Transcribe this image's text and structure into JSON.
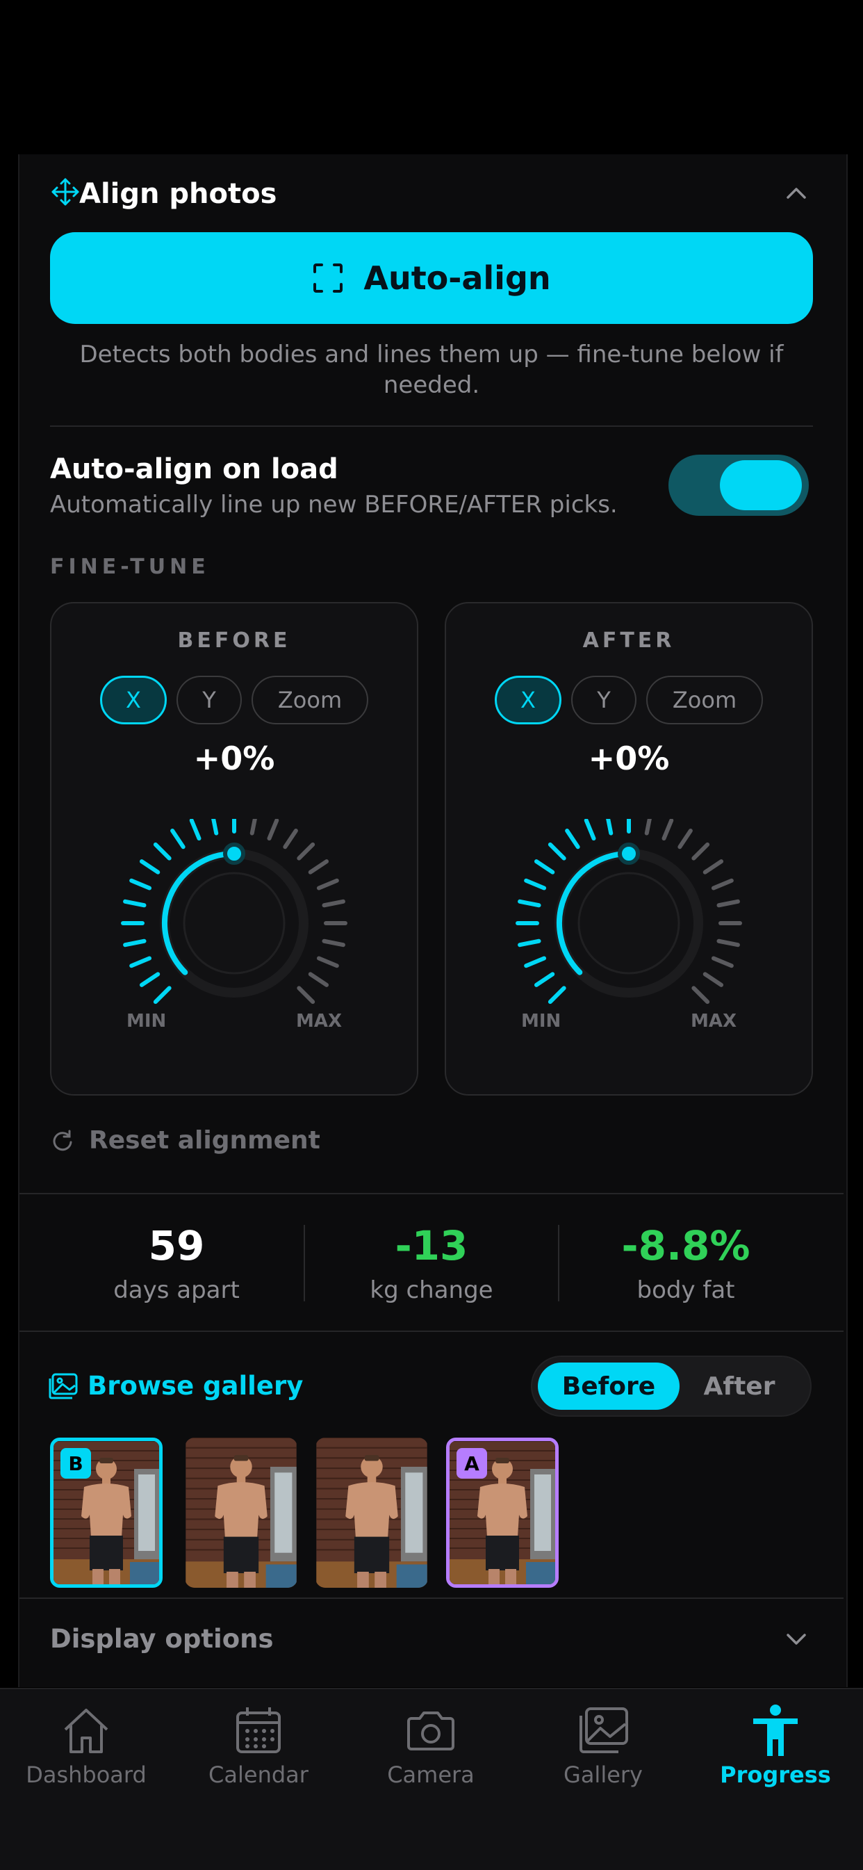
{
  "align_section": {
    "title": "Align photos",
    "auto_align_label": "Auto-align",
    "hint": "Detects both bodies and lines them up — fine-tune below if needed.",
    "auto_on_load_title": "Auto-align on load",
    "auto_on_load_sub": "Automatically line up new BEFORE/AFTER picks.",
    "auto_on_load_enabled": true,
    "fine_tune_label": "FINE-TUNE",
    "cards": [
      {
        "title": "BEFORE",
        "pills": [
          "X",
          "Y",
          "Zoom"
        ],
        "active_pill": "X",
        "value": "+0%",
        "min_label": "MIN",
        "max_label": "MAX",
        "level": 0.5
      },
      {
        "title": "AFTER",
        "pills": [
          "X",
          "Y",
          "Zoom"
        ],
        "active_pill": "X",
        "value": "+0%",
        "min_label": "MIN",
        "max_label": "MAX",
        "level": 0.5
      }
    ],
    "reset_label": "Reset alignment"
  },
  "stats": [
    {
      "value": "59",
      "label": "days apart",
      "color": "#ffffff"
    },
    {
      "value": "-13",
      "label": "kg change",
      "color": "#30d158"
    },
    {
      "value": "-8.8%",
      "label": "body fat",
      "color": "#30d158"
    }
  ],
  "gallery": {
    "browse_label": "Browse gallery",
    "segment": [
      "Before",
      "After"
    ],
    "selected_segment": "Before",
    "badge_before": "B",
    "badge_after": "A"
  },
  "display_options_label": "Display options",
  "tabs": [
    {
      "label": "Dashboard",
      "icon": "home-icon"
    },
    {
      "label": "Calendar",
      "icon": "calendar-icon"
    },
    {
      "label": "Camera",
      "icon": "camera-icon"
    },
    {
      "label": "Gallery",
      "icon": "gallery-icon"
    },
    {
      "label": "Progress",
      "icon": "person-icon",
      "active": true
    }
  ],
  "colors": {
    "accent": "#00d7f5",
    "positive": "#30d158",
    "after_badge": "#b67dff"
  }
}
